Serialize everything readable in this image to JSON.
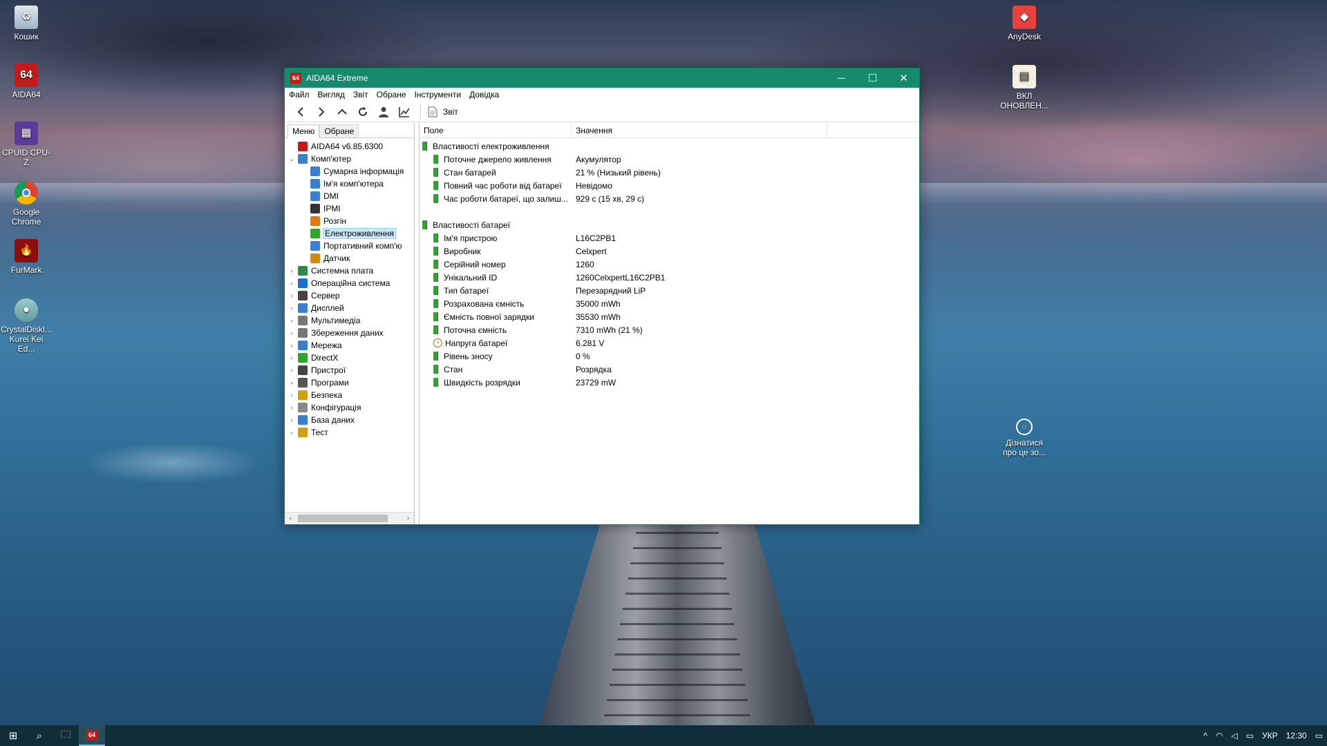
{
  "desktop": {
    "icons": [
      {
        "label": "Кошик",
        "icon": "recycle-bin-icon"
      },
      {
        "label": "AIDA64",
        "icon": "aida64-icon"
      },
      {
        "label": "CPUID CPU-Z",
        "icon": "cpuz-icon"
      },
      {
        "label": "Google Chrome",
        "icon": "chrome-icon"
      },
      {
        "label": "FurMark",
        "icon": "furmark-icon"
      },
      {
        "label": "CrystalDiskI... Kurei Kei Ed...",
        "icon": "crystaldisk-icon"
      },
      {
        "label": "AnyDesk",
        "icon": "anydesk-icon"
      },
      {
        "label": "ВКЛ ОНОВЛЕН...",
        "icon": "file-icon"
      },
      {
        "label": "Дізнатися про це зо...",
        "icon": "info-icon"
      }
    ]
  },
  "window": {
    "logo": "64",
    "title": "AIDA64 Extreme",
    "controls": {
      "minimize": "─",
      "maximize": "☐",
      "close": "✕"
    },
    "menu": [
      "Файл",
      "Вигляд",
      "Звіт",
      "Обране",
      "Інструменти",
      "Довідка"
    ],
    "toolbar": {
      "buttons": [
        "back-icon",
        "forward-icon",
        "up-icon",
        "refresh-icon",
        "user-icon",
        "chart-icon"
      ],
      "report_label": "Звіт"
    },
    "tabs": [
      "Меню",
      "Обране"
    ],
    "tree": [
      {
        "label": "AIDA64 v6.85.6300",
        "level": 0,
        "expand": "",
        "icon": "aida64-icon",
        "color": "#c21b1b"
      },
      {
        "label": "Комп'ютер",
        "level": 0,
        "expand": "⌄",
        "icon": "computer-icon",
        "color": "#3a7fd0"
      },
      {
        "label": "Сумарна інформація",
        "level": 1,
        "expand": "",
        "icon": "summary-icon",
        "color": "#3a7fd0"
      },
      {
        "label": "Ім'я комп'ютера",
        "level": 1,
        "expand": "",
        "icon": "computer-name-icon",
        "color": "#3a7fd0"
      },
      {
        "label": "DMI",
        "level": 1,
        "expand": "",
        "icon": "dmi-icon",
        "color": "#3a7fd0"
      },
      {
        "label": "IPMI",
        "level": 1,
        "expand": "",
        "icon": "ipmi-icon",
        "color": "#333333"
      },
      {
        "label": "Розгін",
        "level": 1,
        "expand": "",
        "icon": "fire-icon",
        "color": "#e07a10"
      },
      {
        "label": "Електроживлення",
        "level": 1,
        "expand": "",
        "icon": "battery-icon",
        "color": "#2fa42f",
        "selected": true
      },
      {
        "label": "Портативний комп'ю",
        "level": 1,
        "expand": "",
        "icon": "laptop-icon",
        "color": "#3a7fd0"
      },
      {
        "label": "Датчик",
        "level": 1,
        "expand": "",
        "icon": "sensor-icon",
        "color": "#d08a10"
      },
      {
        "label": "Системна плата",
        "level": 0,
        "expand": "›",
        "icon": "motherboard-icon",
        "color": "#2a8a4a"
      },
      {
        "label": "Операційна система",
        "level": 0,
        "expand": "›",
        "icon": "windows-icon",
        "color": "#1e6fd0"
      },
      {
        "label": "Сервер",
        "level": 0,
        "expand": "›",
        "icon": "server-icon",
        "color": "#444444"
      },
      {
        "label": "Дисплей",
        "level": 0,
        "expand": "›",
        "icon": "display-icon",
        "color": "#3a7fd0"
      },
      {
        "label": "Мультимедіа",
        "level": 0,
        "expand": "›",
        "icon": "multimedia-icon",
        "color": "#777777"
      },
      {
        "label": "Збереження даних",
        "level": 0,
        "expand": "›",
        "icon": "storage-icon",
        "color": "#777777"
      },
      {
        "label": "Мережа",
        "level": 0,
        "expand": "›",
        "icon": "network-icon",
        "color": "#3a7fd0"
      },
      {
        "label": "DirectX",
        "level": 0,
        "expand": "›",
        "icon": "directx-icon",
        "color": "#2fa42f"
      },
      {
        "label": "Пристрої",
        "level": 0,
        "expand": "›",
        "icon": "devices-icon",
        "color": "#444444"
      },
      {
        "label": "Програми",
        "level": 0,
        "expand": "›",
        "icon": "programs-icon",
        "color": "#555555"
      },
      {
        "label": "Безпека",
        "level": 0,
        "expand": "›",
        "icon": "security-icon",
        "color": "#d0a010"
      },
      {
        "label": "Конфігурація",
        "level": 0,
        "expand": "›",
        "icon": "config-icon",
        "color": "#888888"
      },
      {
        "label": "База даних",
        "level": 0,
        "expand": "›",
        "icon": "database-icon",
        "color": "#3a7fd0"
      },
      {
        "label": "Тест",
        "level": 0,
        "expand": "›",
        "icon": "test-icon",
        "color": "#d0a010"
      }
    ],
    "scroll": {
      "left": "‹",
      "right": "›"
    },
    "columns": {
      "field": "Поле",
      "value": "Значення"
    },
    "groups": [
      {
        "title": "Властивості електроживлення",
        "rows": [
          {
            "field": "Поточне джерело живлення",
            "value": "Акумулятор",
            "icon": "battery-icon"
          },
          {
            "field": "Стан батарей",
            "value": "21 % (Низький рівень)",
            "icon": "battery-icon"
          },
          {
            "field": "Повний час роботи від батареї",
            "value": "Невідомо",
            "icon": "battery-icon"
          },
          {
            "field": "Час роботи батареї, що залиш...",
            "value": "929 с (15 хв, 29 с)",
            "icon": "battery-icon"
          }
        ]
      },
      {
        "title": "Властивості батареї",
        "rows": [
          {
            "field": "Ім'я пристрою",
            "value": "L16C2PB1",
            "icon": "battery-icon"
          },
          {
            "field": "Виробник",
            "value": "Celxpert",
            "icon": "battery-icon"
          },
          {
            "field": "Серійний номер",
            "value": "1260",
            "icon": "battery-icon"
          },
          {
            "field": "Унікальний ID",
            "value": "1260CelxpertL16C2PB1",
            "icon": "battery-icon"
          },
          {
            "field": "Тип батареї",
            "value": "Перезарядний LiP",
            "icon": "battery-icon"
          },
          {
            "field": "Розрахована ємність",
            "value": "35000 mWh",
            "icon": "battery-icon"
          },
          {
            "field": "Ємність повної зарядки",
            "value": "35530 mWh",
            "icon": "battery-icon"
          },
          {
            "field": "Поточна ємність",
            "value": "7310 mWh  (21 %)",
            "icon": "battery-icon"
          },
          {
            "field": "Напруга батареї",
            "value": "6.281 V",
            "icon": "voltage-icon"
          },
          {
            "field": "Рівень зносу",
            "value": "0 %",
            "icon": "battery-icon"
          },
          {
            "field": "Стан",
            "value": "Розрядка",
            "icon": "battery-icon"
          },
          {
            "field": "Швидкість розрядки",
            "value": "23729 mW",
            "icon": "battery-icon"
          }
        ]
      }
    ]
  },
  "taskbar": {
    "start": "⊞",
    "search": "⌕",
    "explorer": "🗀",
    "aida_logo": "64",
    "tray": {
      "chevron": "^",
      "language": "УКР",
      "time": "12:30",
      "notifications": "▭"
    }
  }
}
